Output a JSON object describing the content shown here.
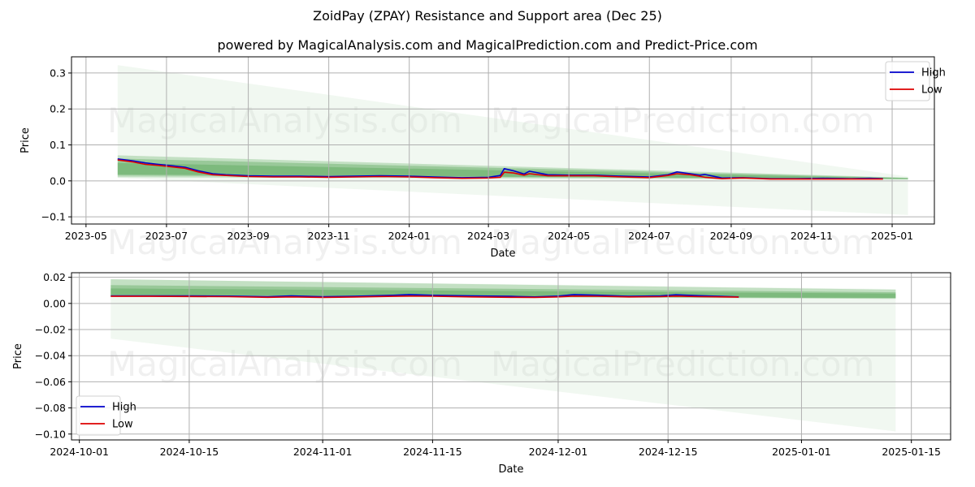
{
  "title": "ZoidPay (ZPAY) Resistance and Support area (Dec 25)",
  "subtitle": "powered by MagicalAnalysis.com and MagicalPrediction.com and Predict-Price.com",
  "watermarks": [
    "MagicalAnalysis.com",
    "MagicalPrediction.com"
  ],
  "colors": {
    "high": "#0000cc",
    "low": "#dd0000",
    "band_light": "#c8e4c8",
    "band_dark": "#5aa85a",
    "grid": "#b0b0b0"
  },
  "chart_data": [
    {
      "type": "line",
      "title": "",
      "xlabel": "Date",
      "ylabel": "Price",
      "ylim": [
        -0.12,
        0.345
      ],
      "xlim": [
        "2023-04-20",
        "2025-02-02"
      ],
      "grid": true,
      "legend": "top-right",
      "x_ticks": [
        "2023-05",
        "2023-07",
        "2023-09",
        "2023-11",
        "2024-01",
        "2024-03",
        "2024-05",
        "2024-07",
        "2024-09",
        "2024-11",
        "2025-01"
      ],
      "y_ticks": [
        "−0.1",
        "0.0",
        "0.1",
        "0.2",
        "0.3"
      ],
      "y_tick_values": [
        -0.1,
        0.0,
        0.1,
        0.2,
        0.3
      ],
      "bands": [
        {
          "name": "wide-support-resistance",
          "x": [
            "2023-05-25",
            "2025-01-13"
          ],
          "upper": [
            0.322,
            0.012
          ],
          "lower": [
            0.008,
            -0.095
          ],
          "opacity": 0.25
        },
        {
          "name": "resistance-band-1",
          "x": [
            "2023-05-25",
            "2025-01-13"
          ],
          "upper": [
            0.071,
            0.009
          ],
          "lower": [
            0.01,
            0.004
          ],
          "opacity": 0.3
        },
        {
          "name": "resistance-band-2",
          "x": [
            "2023-05-25",
            "2025-01-13"
          ],
          "upper": [
            0.062,
            0.008
          ],
          "lower": [
            0.015,
            0.005
          ],
          "opacity": 0.4
        },
        {
          "name": "resistance-band-3",
          "x": [
            "2023-05-25",
            "2025-01-13"
          ],
          "upper": [
            0.05,
            0.007
          ],
          "lower": [
            0.018,
            0.005
          ],
          "opacity": 0.45
        }
      ],
      "series": [
        {
          "name": "High",
          "x": [
            "2023-05-25",
            "2023-06-05",
            "2023-06-15",
            "2023-06-25",
            "2023-07-05",
            "2023-07-15",
            "2023-07-25",
            "2023-08-05",
            "2023-08-15",
            "2023-09-01",
            "2023-09-20",
            "2023-10-10",
            "2023-11-01",
            "2023-11-20",
            "2023-12-10",
            "2024-01-01",
            "2024-01-20",
            "2024-02-10",
            "2024-03-01",
            "2024-03-10",
            "2024-03-13",
            "2024-03-20",
            "2024-03-28",
            "2024-04-01",
            "2024-04-15",
            "2024-05-01",
            "2024-05-20",
            "2024-06-10",
            "2024-07-01",
            "2024-07-15",
            "2024-07-22",
            "2024-08-01",
            "2024-08-08",
            "2024-08-12",
            "2024-08-25",
            "2024-09-10",
            "2024-10-01",
            "2024-10-20",
            "2024-11-10",
            "2024-12-01",
            "2024-12-15",
            "2024-12-25"
          ],
          "values": [
            0.061,
            0.056,
            0.05,
            0.046,
            0.042,
            0.038,
            0.028,
            0.02,
            0.017,
            0.014,
            0.013,
            0.013,
            0.012,
            0.013,
            0.014,
            0.013,
            0.011,
            0.009,
            0.01,
            0.015,
            0.034,
            0.028,
            0.019,
            0.027,
            0.017,
            0.016,
            0.016,
            0.013,
            0.011,
            0.017,
            0.025,
            0.02,
            0.016,
            0.018,
            0.008,
            0.009,
            0.006,
            0.006,
            0.007,
            0.006,
            0.007,
            0.006
          ]
        },
        {
          "name": "Low",
          "x": [
            "2023-05-25",
            "2023-06-05",
            "2023-06-15",
            "2023-06-25",
            "2023-07-05",
            "2023-07-15",
            "2023-07-25",
            "2023-08-05",
            "2023-08-15",
            "2023-09-01",
            "2023-09-20",
            "2023-10-10",
            "2023-11-01",
            "2023-11-20",
            "2023-12-10",
            "2024-01-01",
            "2024-01-20",
            "2024-02-10",
            "2024-03-01",
            "2024-03-10",
            "2024-03-13",
            "2024-03-20",
            "2024-03-28",
            "2024-04-01",
            "2024-04-15",
            "2024-05-01",
            "2024-05-20",
            "2024-06-10",
            "2024-07-01",
            "2024-07-15",
            "2024-07-22",
            "2024-08-01",
            "2024-08-08",
            "2024-08-12",
            "2024-08-25",
            "2024-09-10",
            "2024-10-01",
            "2024-10-20",
            "2024-11-10",
            "2024-12-01",
            "2024-12-15",
            "2024-12-25"
          ],
          "values": [
            0.058,
            0.053,
            0.046,
            0.043,
            0.039,
            0.035,
            0.025,
            0.017,
            0.015,
            0.012,
            0.011,
            0.011,
            0.01,
            0.011,
            0.012,
            0.011,
            0.009,
            0.007,
            0.008,
            0.01,
            0.024,
            0.022,
            0.016,
            0.02,
            0.014,
            0.014,
            0.014,
            0.011,
            0.009,
            0.015,
            0.02,
            0.017,
            0.013,
            0.01,
            0.006,
            0.008,
            0.005,
            0.005,
            0.005,
            0.005,
            0.005,
            0.005
          ]
        }
      ]
    },
    {
      "type": "line",
      "title": "",
      "xlabel": "Date",
      "ylabel": "Price",
      "ylim": [
        -0.1045,
        0.0235
      ],
      "xlim": [
        "2024-09-30",
        "2025-01-20"
      ],
      "grid": true,
      "legend": "bottom-left",
      "x_ticks": [
        "2024-10-01",
        "2024-10-15",
        "2024-11-01",
        "2024-11-15",
        "2024-12-01",
        "2024-12-15",
        "2025-01-01",
        "2025-01-15"
      ],
      "y_ticks": [
        "−0.10",
        "−0.08",
        "−0.06",
        "−0.04",
        "−0.02",
        "0.00",
        "0.02"
      ],
      "y_tick_values": [
        -0.1,
        -0.08,
        -0.06,
        -0.04,
        -0.02,
        0.0,
        0.02
      ],
      "bands": [
        {
          "name": "wide-support-resistance",
          "x": [
            "2024-10-05",
            "2025-01-13"
          ],
          "upper": [
            0.0185,
            0.011
          ],
          "lower": [
            -0.027,
            -0.098
          ],
          "opacity": 0.25
        },
        {
          "name": "resistance-band-1",
          "x": [
            "2024-10-05",
            "2025-01-13"
          ],
          "upper": [
            0.0185,
            0.0105
          ],
          "lower": [
            0.006,
            0.0035
          ],
          "opacity": 0.3
        },
        {
          "name": "resistance-band-2",
          "x": [
            "2024-10-05",
            "2025-01-13"
          ],
          "upper": [
            0.014,
            0.0085
          ],
          "lower": [
            0.006,
            0.004
          ],
          "opacity": 0.4
        },
        {
          "name": "resistance-band-3",
          "x": [
            "2024-10-05",
            "2025-01-13"
          ],
          "upper": [
            0.0115,
            0.0075
          ],
          "lower": [
            0.0065,
            0.0042
          ],
          "opacity": 0.45
        }
      ],
      "series": [
        {
          "name": "High",
          "x": [
            "2024-10-05",
            "2024-10-10",
            "2024-10-15",
            "2024-10-20",
            "2024-10-25",
            "2024-10-28",
            "2024-11-01",
            "2024-11-05",
            "2024-11-10",
            "2024-11-12",
            "2024-11-15",
            "2024-11-20",
            "2024-11-25",
            "2024-11-28",
            "2024-12-01",
            "2024-12-03",
            "2024-12-06",
            "2024-12-10",
            "2024-12-14",
            "2024-12-16",
            "2024-12-19",
            "2024-12-24"
          ],
          "values": [
            0.0058,
            0.0058,
            0.0058,
            0.0056,
            0.0052,
            0.0057,
            0.0052,
            0.0054,
            0.0062,
            0.0068,
            0.0062,
            0.0058,
            0.0054,
            0.005,
            0.0056,
            0.0068,
            0.0063,
            0.0054,
            0.0058,
            0.0066,
            0.0059,
            0.005
          ]
        },
        {
          "name": "Low",
          "x": [
            "2024-10-05",
            "2024-10-10",
            "2024-10-15",
            "2024-10-20",
            "2024-10-25",
            "2024-10-28",
            "2024-11-01",
            "2024-11-05",
            "2024-11-10",
            "2024-11-12",
            "2024-11-15",
            "2024-11-20",
            "2024-11-25",
            "2024-11-28",
            "2024-12-01",
            "2024-12-03",
            "2024-12-06",
            "2024-12-10",
            "2024-12-14",
            "2024-12-16",
            "2024-12-19",
            "2024-12-24"
          ],
          "values": [
            0.0054,
            0.0054,
            0.0053,
            0.0052,
            0.0047,
            0.005,
            0.0046,
            0.0049,
            0.0054,
            0.0056,
            0.0055,
            0.005,
            0.0047,
            0.0046,
            0.005,
            0.0056,
            0.0055,
            0.005,
            0.0052,
            0.0056,
            0.0052,
            0.0048
          ]
        }
      ]
    }
  ]
}
